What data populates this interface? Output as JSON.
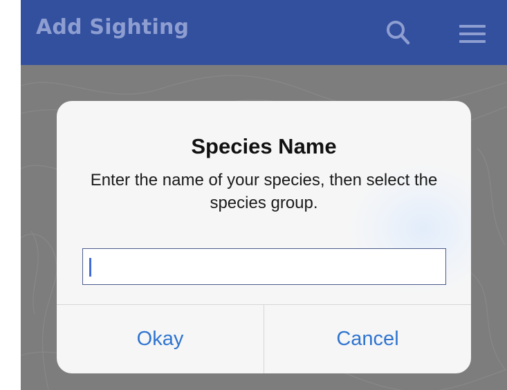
{
  "header": {
    "title": "Add Sighting",
    "icons": [
      "search-icon",
      "menu-icon"
    ],
    "background": "#33509f"
  },
  "dialog": {
    "title": "Species Name",
    "message": "Enter the name of your species, then select the species group.",
    "input": {
      "value": "",
      "placeholder": ""
    },
    "buttons": {
      "okay": "Okay",
      "cancel": "Cancel"
    },
    "accent": "#2f74d0"
  }
}
